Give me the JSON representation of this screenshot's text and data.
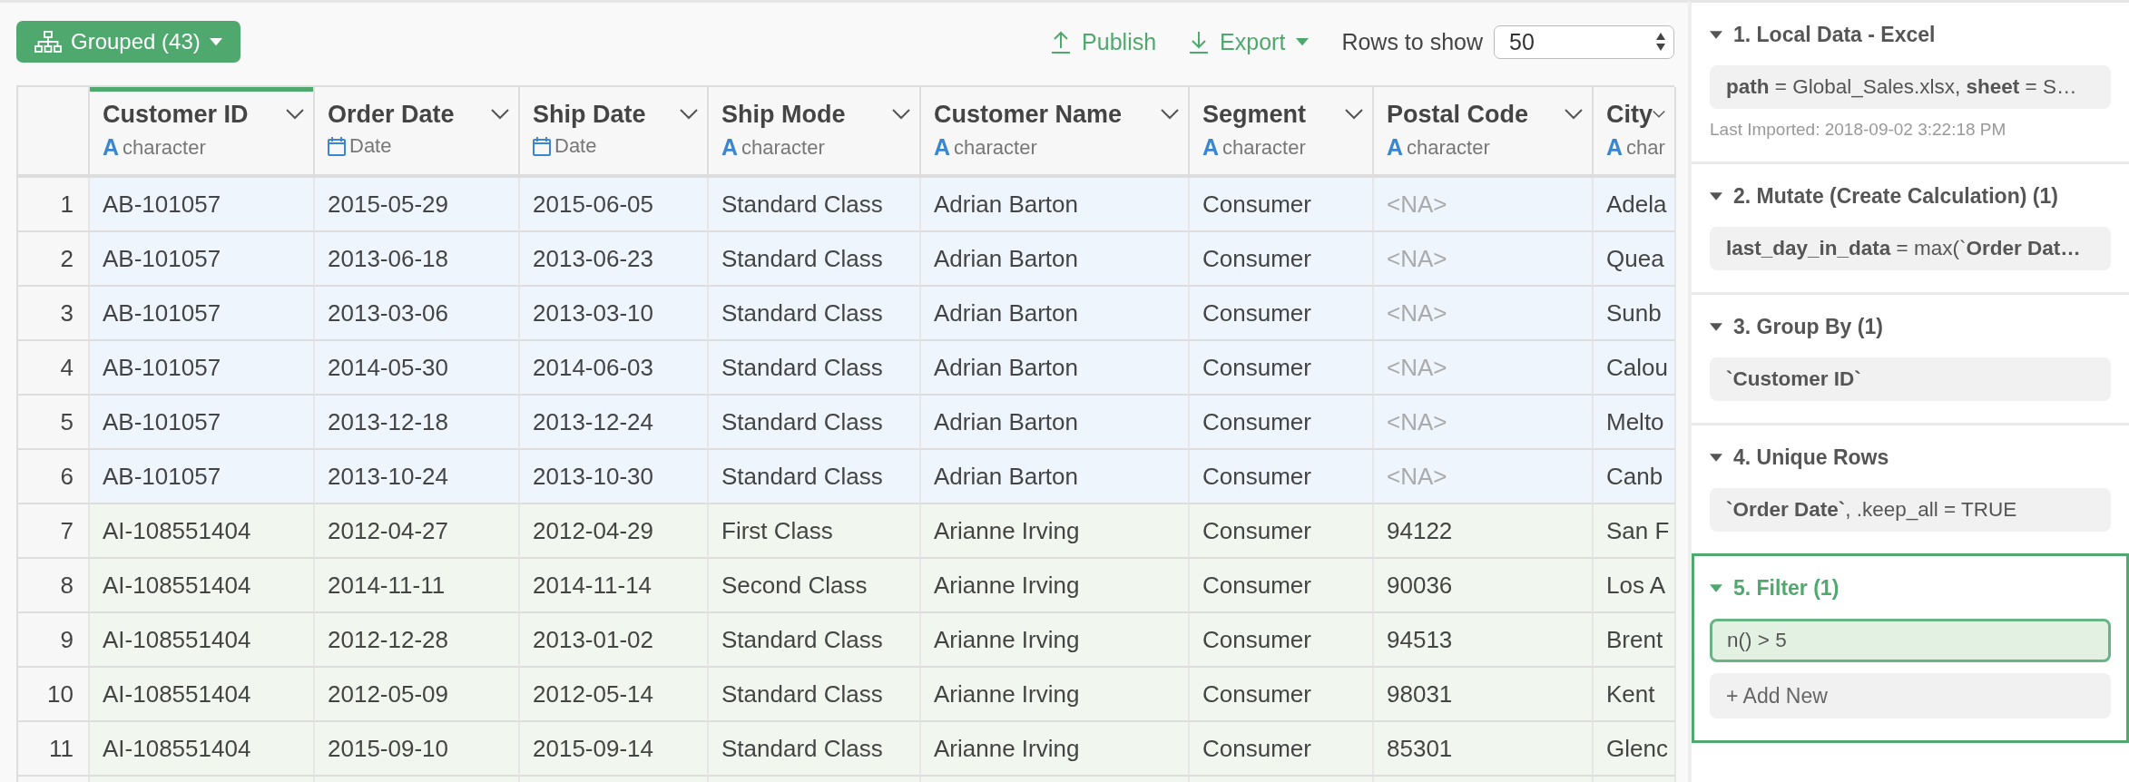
{
  "toolbar": {
    "group_button": {
      "label": "Grouped (43)"
    },
    "publish": {
      "label": "Publish"
    },
    "export": {
      "label": "Export"
    },
    "rows_to_show": {
      "label": "Rows to show",
      "value": "50"
    }
  },
  "table": {
    "columns": [
      {
        "name": "Customer ID",
        "kind": "character",
        "type_icon": "A",
        "type": "character",
        "selected": true
      },
      {
        "name": "Order Date",
        "kind": "date",
        "type": "Date",
        "selected": false
      },
      {
        "name": "Ship Date",
        "kind": "date",
        "type": "Date",
        "selected": false
      },
      {
        "name": "Ship Mode",
        "kind": "character",
        "type_icon": "A",
        "type": "character",
        "selected": false
      },
      {
        "name": "Customer Name",
        "kind": "character",
        "type_icon": "A",
        "type": "character",
        "selected": false
      },
      {
        "name": "Segment",
        "kind": "character",
        "type_icon": "A",
        "type": "character",
        "selected": false
      },
      {
        "name": "Postal Code",
        "kind": "character",
        "type_icon": "A",
        "type": "character",
        "selected": false
      },
      {
        "name": "City",
        "kind": "character",
        "type_icon": "A",
        "type": "char",
        "selected": false
      }
    ],
    "rows": [
      {
        "num": "1",
        "color": "#eef5fd",
        "cells": [
          "AB-101057",
          "2015-05-29",
          "2015-06-05",
          "Standard Class",
          "Adrian Barton",
          "Consumer",
          "<NA>",
          "Adela"
        ]
      },
      {
        "num": "2",
        "color": "#eef5fd",
        "cells": [
          "AB-101057",
          "2013-06-18",
          "2013-06-23",
          "Standard Class",
          "Adrian Barton",
          "Consumer",
          "<NA>",
          "Quea"
        ]
      },
      {
        "num": "3",
        "color": "#eef5fd",
        "cells": [
          "AB-101057",
          "2013-03-06",
          "2013-03-10",
          "Standard Class",
          "Adrian Barton",
          "Consumer",
          "<NA>",
          "Sunb"
        ]
      },
      {
        "num": "4",
        "color": "#eef5fd",
        "cells": [
          "AB-101057",
          "2014-05-30",
          "2014-06-03",
          "Standard Class",
          "Adrian Barton",
          "Consumer",
          "<NA>",
          "Calou"
        ]
      },
      {
        "num": "5",
        "color": "#eef5fd",
        "cells": [
          "AB-101057",
          "2013-12-18",
          "2013-12-24",
          "Standard Class",
          "Adrian Barton",
          "Consumer",
          "<NA>",
          "Melto"
        ]
      },
      {
        "num": "6",
        "color": "#eef5fd",
        "cells": [
          "AB-101057",
          "2013-10-24",
          "2013-10-30",
          "Standard Class",
          "Adrian Barton",
          "Consumer",
          "<NA>",
          "Canb"
        ]
      },
      {
        "num": "7",
        "color": "#f1f7ee",
        "cells": [
          "AI-108551404",
          "2012-04-27",
          "2012-04-29",
          "First Class",
          "Arianne Irving",
          "Consumer",
          "94122",
          "San F"
        ]
      },
      {
        "num": "8",
        "color": "#f1f7ee",
        "cells": [
          "AI-108551404",
          "2014-11-11",
          "2014-11-14",
          "Second Class",
          "Arianne Irving",
          "Consumer",
          "90036",
          "Los A"
        ]
      },
      {
        "num": "9",
        "color": "#f1f7ee",
        "cells": [
          "AI-108551404",
          "2012-12-28",
          "2013-01-02",
          "Standard Class",
          "Arianne Irving",
          "Consumer",
          "94513",
          "Brent"
        ]
      },
      {
        "num": "10",
        "color": "#f1f7ee",
        "cells": [
          "AI-108551404",
          "2012-05-09",
          "2012-05-14",
          "Standard Class",
          "Arianne Irving",
          "Consumer",
          "98031",
          "Kent"
        ]
      },
      {
        "num": "11",
        "color": "#f1f7ee",
        "cells": [
          "AI-108551404",
          "2015-09-10",
          "2015-09-14",
          "Standard Class",
          "Arianne Irving",
          "Consumer",
          "85301",
          "Glenc"
        ]
      }
    ]
  },
  "steps": [
    {
      "title": "1. Local Data - Excel",
      "selected": false,
      "expanded": true,
      "items": [
        {
          "text": "**path** = Global_Sales.xlsx, **sheet** = S…",
          "bold": false,
          "selected": false
        }
      ],
      "note": "Last Imported: 2018-09-02 3:22:18 PM"
    },
    {
      "title": "2. Mutate (Create Calculation) (1)",
      "selected": false,
      "expanded": true,
      "items": [
        {
          "text": "**last_day_in_data** = max(`**Order Dat…**",
          "bold": false,
          "selected": false
        }
      ]
    },
    {
      "title": "3. Group By (1)",
      "selected": false,
      "expanded": true,
      "items": [
        {
          "text": "`Customer ID`",
          "bold": true,
          "selected": false
        }
      ]
    },
    {
      "title": "4. Unique Rows",
      "selected": false,
      "expanded": true,
      "items": [
        {
          "text": "**`Order Date`**, .keep_all = TRUE",
          "bold": false,
          "selected": false
        }
      ]
    },
    {
      "title": "5. Filter (1)",
      "selected": true,
      "expanded": true,
      "items": [
        {
          "text": "n() > 5",
          "bold": false,
          "selected": true
        }
      ],
      "add_new": "+ Add New"
    }
  ]
}
